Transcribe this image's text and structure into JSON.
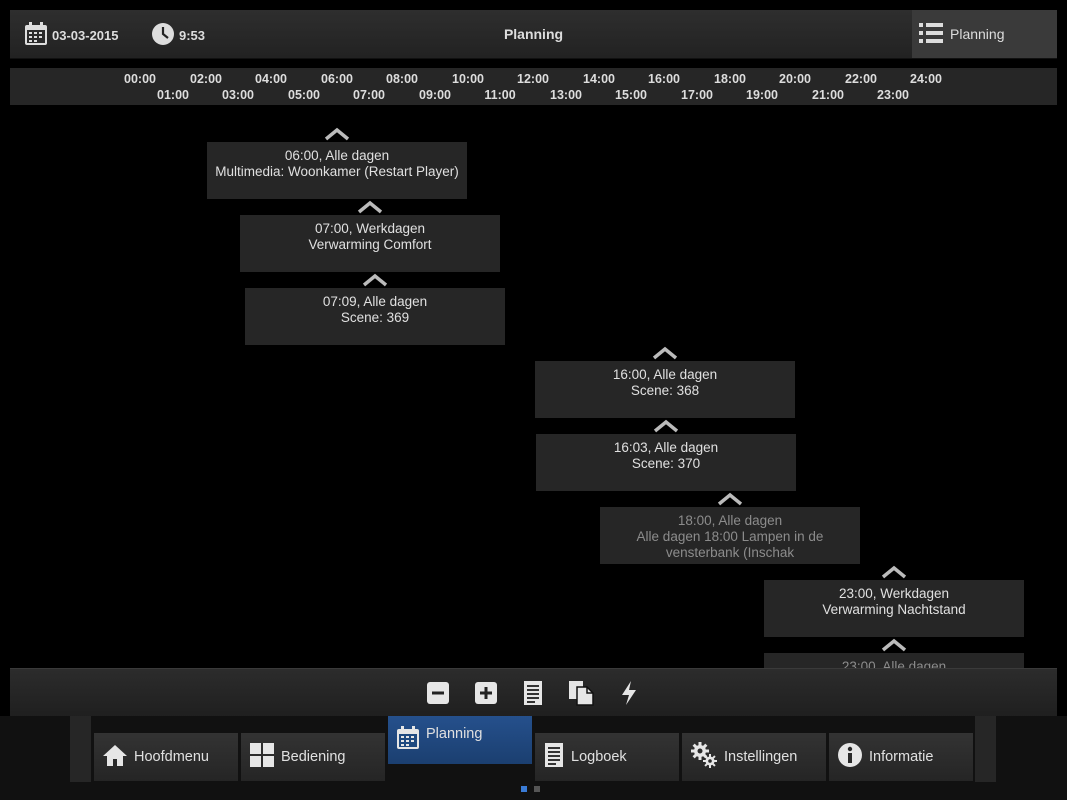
{
  "header": {
    "date": "03-03-2015",
    "time": "9:53",
    "title": "Planning",
    "view_button_label": "Planning"
  },
  "timeline": {
    "top_labels": [
      "00:00",
      "02:00",
      "04:00",
      "06:00",
      "08:00",
      "10:00",
      "12:00",
      "14:00",
      "16:00",
      "18:00",
      "20:00",
      "22:00",
      "24:00"
    ],
    "bottom_labels": [
      "01:00",
      "03:00",
      "05:00",
      "07:00",
      "09:00",
      "11:00",
      "13:00",
      "15:00",
      "17:00",
      "19:00",
      "21:00",
      "23:00"
    ]
  },
  "events": [
    {
      "line1": "06:00, Alle dagen",
      "line2": "Multimedia: Woonkamer (Restart Player)",
      "dimmed": false
    },
    {
      "line1": "07:00, Werkdagen",
      "line2": "Verwarming Comfort",
      "dimmed": false
    },
    {
      "line1": "07:09, Alle dagen",
      "line2": "Scene: 369",
      "dimmed": false
    },
    {
      "line1": "16:00, Alle dagen",
      "line2": "Scene: 368",
      "dimmed": false
    },
    {
      "line1": "16:03, Alle dagen",
      "line2": "Scene: 370",
      "dimmed": false
    },
    {
      "line1": "18:00, Alle dagen",
      "line2": "Alle dagen 18:00 Lampen in de vensterbank (Inschak",
      "dimmed": true
    },
    {
      "line1": "23:00, Werkdagen",
      "line2": "Verwarming Nachtstand",
      "dimmed": false
    },
    {
      "line1": "23:00, Alle dagen",
      "line2": "",
      "dimmed": true
    }
  ],
  "toolbar": {
    "icons": [
      "minus-icon",
      "plus-icon",
      "document-icon",
      "copy-icon",
      "lightning-icon"
    ]
  },
  "nav": {
    "items": [
      {
        "label": "Hoofdmenu",
        "icon": "home-icon"
      },
      {
        "label": "Bediening",
        "icon": "grid-icon"
      },
      {
        "label": "Planning",
        "icon": "calendar-icon",
        "active": true
      },
      {
        "label": "Logboek",
        "icon": "logbook-icon"
      },
      {
        "label": "Instellingen",
        "icon": "gears-icon"
      },
      {
        "label": "Informatie",
        "icon": "info-icon"
      }
    ],
    "page_count": 2,
    "current_page": 1
  },
  "colors": {
    "background": "#000000",
    "panel": "#262626",
    "active_tab": "#1f4a80",
    "pager_active": "#3a7bd5"
  }
}
